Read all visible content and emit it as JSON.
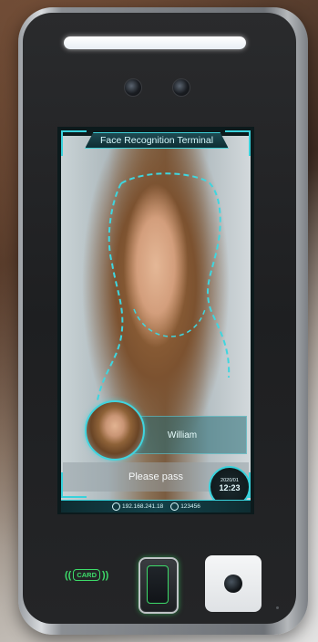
{
  "screen": {
    "title": "Face Recognition Terminal",
    "matched_name": "William",
    "status_message": "Please pass",
    "clock": {
      "date": "2020/01",
      "time": "12:23"
    },
    "ip_address": "192.168.241.18",
    "device_id": "123456"
  },
  "hardware": {
    "card_reader_label": "CARD",
    "card_wave_left": "((",
    "card_wave_right": "))"
  },
  "colors": {
    "accent": "#39d2dc",
    "card_indicator": "#3ddc6a",
    "housing": "#1e1f21"
  }
}
